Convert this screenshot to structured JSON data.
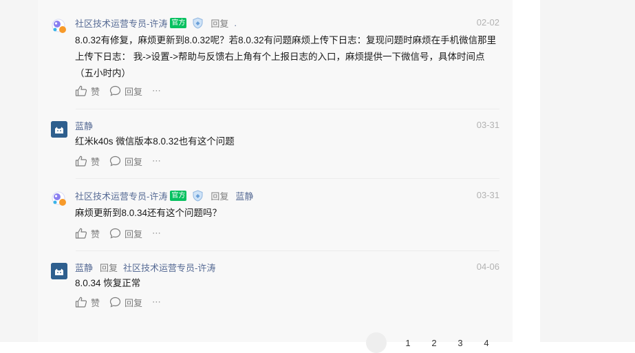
{
  "comments": [
    {
      "author": "社区技术运营专员-许涛",
      "official_badge": "官方",
      "reply_label": "回复",
      "reply_to": ".",
      "date": "02-02",
      "text": "8.0.32有修复，麻烦更新到8.0.32呢？若8.0.32有问题麻烦上传下日志：复现问题时麻烦在手机微信那里上传下日志： 我->设置->帮助与反馈右上角有个上报日志的入口，麻烦提供一下微信号，具体时间点（五小时内）",
      "like_label": "赞",
      "reply_action": "回复",
      "more_label": "⋯"
    },
    {
      "author": "蓝静",
      "date": "03-31",
      "text": "红米k40s 微信版本8.0.32也有这个问题",
      "like_label": "赞",
      "reply_action": "回复",
      "more_label": "⋯"
    },
    {
      "author": "社区技术运营专员-许涛",
      "official_badge": "官方",
      "reply_label": "回复",
      "reply_to": "蓝静",
      "date": "03-31",
      "text": "麻烦更新到8.0.34还有这个问题吗？",
      "like_label": "赞",
      "reply_action": "回复",
      "more_label": "⋯"
    },
    {
      "author": "蓝静",
      "reply_label": "回复",
      "reply_to": "社区技术运营专员-许涛",
      "date": "04-06",
      "text": "8.0.34 恢复正常",
      "like_label": "赞",
      "reply_action": "回复",
      "more_label": "⋯"
    }
  ],
  "pagination": {
    "pages": [
      "1",
      "2",
      "3",
      "4"
    ]
  },
  "colors": {
    "link": "#576b95",
    "badge": "#07c160",
    "avatar_blue": "#2e5f8e"
  }
}
